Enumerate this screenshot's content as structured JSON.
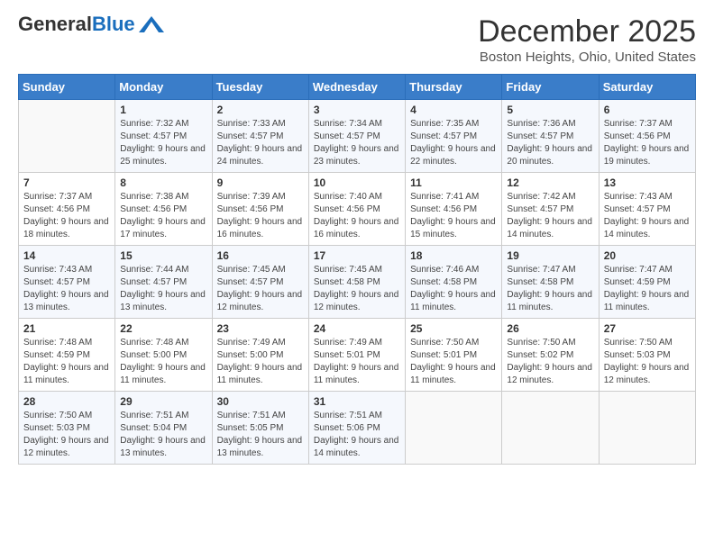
{
  "header": {
    "logo_line1": "General",
    "logo_line2": "Blue",
    "month_title": "December 2025",
    "location": "Boston Heights, Ohio, United States"
  },
  "weekdays": [
    "Sunday",
    "Monday",
    "Tuesday",
    "Wednesday",
    "Thursday",
    "Friday",
    "Saturday"
  ],
  "weeks": [
    [
      {
        "day": "",
        "sunrise": "",
        "sunset": "",
        "daylight": ""
      },
      {
        "day": "1",
        "sunrise": "Sunrise: 7:32 AM",
        "sunset": "Sunset: 4:57 PM",
        "daylight": "Daylight: 9 hours and 25 minutes."
      },
      {
        "day": "2",
        "sunrise": "Sunrise: 7:33 AM",
        "sunset": "Sunset: 4:57 PM",
        "daylight": "Daylight: 9 hours and 24 minutes."
      },
      {
        "day": "3",
        "sunrise": "Sunrise: 7:34 AM",
        "sunset": "Sunset: 4:57 PM",
        "daylight": "Daylight: 9 hours and 23 minutes."
      },
      {
        "day": "4",
        "sunrise": "Sunrise: 7:35 AM",
        "sunset": "Sunset: 4:57 PM",
        "daylight": "Daylight: 9 hours and 22 minutes."
      },
      {
        "day": "5",
        "sunrise": "Sunrise: 7:36 AM",
        "sunset": "Sunset: 4:57 PM",
        "daylight": "Daylight: 9 hours and 20 minutes."
      },
      {
        "day": "6",
        "sunrise": "Sunrise: 7:37 AM",
        "sunset": "Sunset: 4:56 PM",
        "daylight": "Daylight: 9 hours and 19 minutes."
      }
    ],
    [
      {
        "day": "7",
        "sunrise": "Sunrise: 7:37 AM",
        "sunset": "Sunset: 4:56 PM",
        "daylight": "Daylight: 9 hours and 18 minutes."
      },
      {
        "day": "8",
        "sunrise": "Sunrise: 7:38 AM",
        "sunset": "Sunset: 4:56 PM",
        "daylight": "Daylight: 9 hours and 17 minutes."
      },
      {
        "day": "9",
        "sunrise": "Sunrise: 7:39 AM",
        "sunset": "Sunset: 4:56 PM",
        "daylight": "Daylight: 9 hours and 16 minutes."
      },
      {
        "day": "10",
        "sunrise": "Sunrise: 7:40 AM",
        "sunset": "Sunset: 4:56 PM",
        "daylight": "Daylight: 9 hours and 16 minutes."
      },
      {
        "day": "11",
        "sunrise": "Sunrise: 7:41 AM",
        "sunset": "Sunset: 4:56 PM",
        "daylight": "Daylight: 9 hours and 15 minutes."
      },
      {
        "day": "12",
        "sunrise": "Sunrise: 7:42 AM",
        "sunset": "Sunset: 4:57 PM",
        "daylight": "Daylight: 9 hours and 14 minutes."
      },
      {
        "day": "13",
        "sunrise": "Sunrise: 7:43 AM",
        "sunset": "Sunset: 4:57 PM",
        "daylight": "Daylight: 9 hours and 14 minutes."
      }
    ],
    [
      {
        "day": "14",
        "sunrise": "Sunrise: 7:43 AM",
        "sunset": "Sunset: 4:57 PM",
        "daylight": "Daylight: 9 hours and 13 minutes."
      },
      {
        "day": "15",
        "sunrise": "Sunrise: 7:44 AM",
        "sunset": "Sunset: 4:57 PM",
        "daylight": "Daylight: 9 hours and 13 minutes."
      },
      {
        "day": "16",
        "sunrise": "Sunrise: 7:45 AM",
        "sunset": "Sunset: 4:57 PM",
        "daylight": "Daylight: 9 hours and 12 minutes."
      },
      {
        "day": "17",
        "sunrise": "Sunrise: 7:45 AM",
        "sunset": "Sunset: 4:58 PM",
        "daylight": "Daylight: 9 hours and 12 minutes."
      },
      {
        "day": "18",
        "sunrise": "Sunrise: 7:46 AM",
        "sunset": "Sunset: 4:58 PM",
        "daylight": "Daylight: 9 hours and 11 minutes."
      },
      {
        "day": "19",
        "sunrise": "Sunrise: 7:47 AM",
        "sunset": "Sunset: 4:58 PM",
        "daylight": "Daylight: 9 hours and 11 minutes."
      },
      {
        "day": "20",
        "sunrise": "Sunrise: 7:47 AM",
        "sunset": "Sunset: 4:59 PM",
        "daylight": "Daylight: 9 hours and 11 minutes."
      }
    ],
    [
      {
        "day": "21",
        "sunrise": "Sunrise: 7:48 AM",
        "sunset": "Sunset: 4:59 PM",
        "daylight": "Daylight: 9 hours and 11 minutes."
      },
      {
        "day": "22",
        "sunrise": "Sunrise: 7:48 AM",
        "sunset": "Sunset: 5:00 PM",
        "daylight": "Daylight: 9 hours and 11 minutes."
      },
      {
        "day": "23",
        "sunrise": "Sunrise: 7:49 AM",
        "sunset": "Sunset: 5:00 PM",
        "daylight": "Daylight: 9 hours and 11 minutes."
      },
      {
        "day": "24",
        "sunrise": "Sunrise: 7:49 AM",
        "sunset": "Sunset: 5:01 PM",
        "daylight": "Daylight: 9 hours and 11 minutes."
      },
      {
        "day": "25",
        "sunrise": "Sunrise: 7:50 AM",
        "sunset": "Sunset: 5:01 PM",
        "daylight": "Daylight: 9 hours and 11 minutes."
      },
      {
        "day": "26",
        "sunrise": "Sunrise: 7:50 AM",
        "sunset": "Sunset: 5:02 PM",
        "daylight": "Daylight: 9 hours and 12 minutes."
      },
      {
        "day": "27",
        "sunrise": "Sunrise: 7:50 AM",
        "sunset": "Sunset: 5:03 PM",
        "daylight": "Daylight: 9 hours and 12 minutes."
      }
    ],
    [
      {
        "day": "28",
        "sunrise": "Sunrise: 7:50 AM",
        "sunset": "Sunset: 5:03 PM",
        "daylight": "Daylight: 9 hours and 12 minutes."
      },
      {
        "day": "29",
        "sunrise": "Sunrise: 7:51 AM",
        "sunset": "Sunset: 5:04 PM",
        "daylight": "Daylight: 9 hours and 13 minutes."
      },
      {
        "day": "30",
        "sunrise": "Sunrise: 7:51 AM",
        "sunset": "Sunset: 5:05 PM",
        "daylight": "Daylight: 9 hours and 13 minutes."
      },
      {
        "day": "31",
        "sunrise": "Sunrise: 7:51 AM",
        "sunset": "Sunset: 5:06 PM",
        "daylight": "Daylight: 9 hours and 14 minutes."
      },
      {
        "day": "",
        "sunrise": "",
        "sunset": "",
        "daylight": ""
      },
      {
        "day": "",
        "sunrise": "",
        "sunset": "",
        "daylight": ""
      },
      {
        "day": "",
        "sunrise": "",
        "sunset": "",
        "daylight": ""
      }
    ]
  ]
}
